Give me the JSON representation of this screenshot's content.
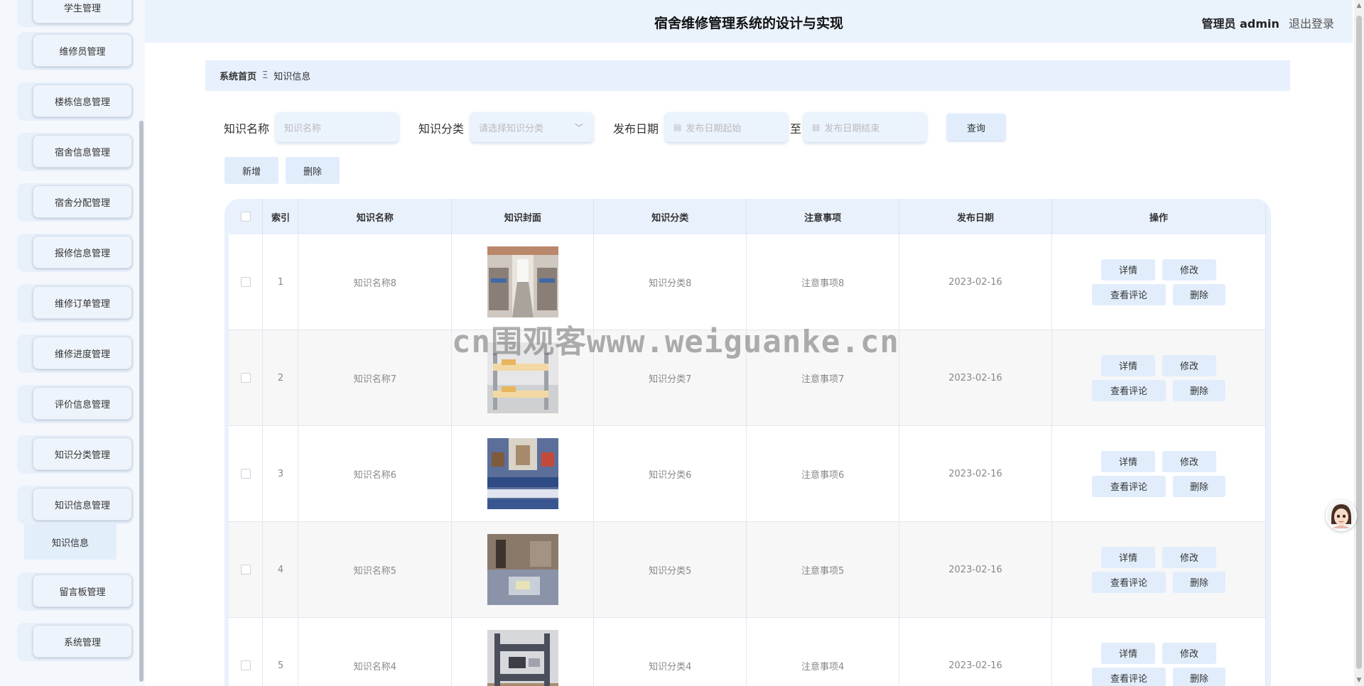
{
  "header": {
    "title": "宿舍维修管理系统的设计与实现",
    "user_role": "管理员 admin",
    "logout": "退出登录"
  },
  "sidebar": {
    "items": [
      {
        "label": "学生管理"
      },
      {
        "label": "维修员管理"
      },
      {
        "label": "楼栋信息管理"
      },
      {
        "label": "宿舍信息管理"
      },
      {
        "label": "宿舍分配管理"
      },
      {
        "label": "报修信息管理"
      },
      {
        "label": "维修订单管理"
      },
      {
        "label": "维修进度管理"
      },
      {
        "label": "评价信息管理"
      },
      {
        "label": "知识分类管理"
      },
      {
        "label": "知识信息管理"
      },
      {
        "label": "留言板管理"
      },
      {
        "label": "系统管理"
      }
    ],
    "active_sub": "知识信息"
  },
  "breadcrumb": {
    "home": "系统首页",
    "separator": "Ξ",
    "current": "知识信息"
  },
  "search": {
    "name_label": "知识名称",
    "name_placeholder": "知识名称",
    "category_label": "知识分类",
    "category_placeholder": "请选择知识分类",
    "date_label": "发布日期",
    "date_start_placeholder": "发布日期起始",
    "date_to": "至",
    "date_end_placeholder": "发布日期结束",
    "query_button": "查询"
  },
  "actions": {
    "add": "新增",
    "delete": "删除"
  },
  "table": {
    "columns": [
      "索引",
      "知识名称",
      "知识封面",
      "知识分类",
      "注意事项",
      "发布日期",
      "操作"
    ],
    "rows": [
      {
        "index": "1",
        "name": "知识名称8",
        "category": "知识分类8",
        "notes": "注意事项8",
        "date": "2023-02-16"
      },
      {
        "index": "2",
        "name": "知识名称7",
        "category": "知识分类7",
        "notes": "注意事项7",
        "date": "2023-02-16"
      },
      {
        "index": "3",
        "name": "知识名称6",
        "category": "知识分类6",
        "notes": "注意事项6",
        "date": "2023-02-16"
      },
      {
        "index": "4",
        "name": "知识名称5",
        "category": "知识分类5",
        "notes": "注意事项5",
        "date": "2023-02-16"
      },
      {
        "index": "5",
        "name": "知识名称4",
        "category": "知识分类4",
        "notes": "注意事项4",
        "date": "2023-02-16"
      }
    ],
    "row_ops": {
      "detail": "详情",
      "edit": "修改",
      "comments": "查看评论",
      "delete": "删除"
    }
  },
  "watermark": "cn围观客www.weiguanke.cn"
}
